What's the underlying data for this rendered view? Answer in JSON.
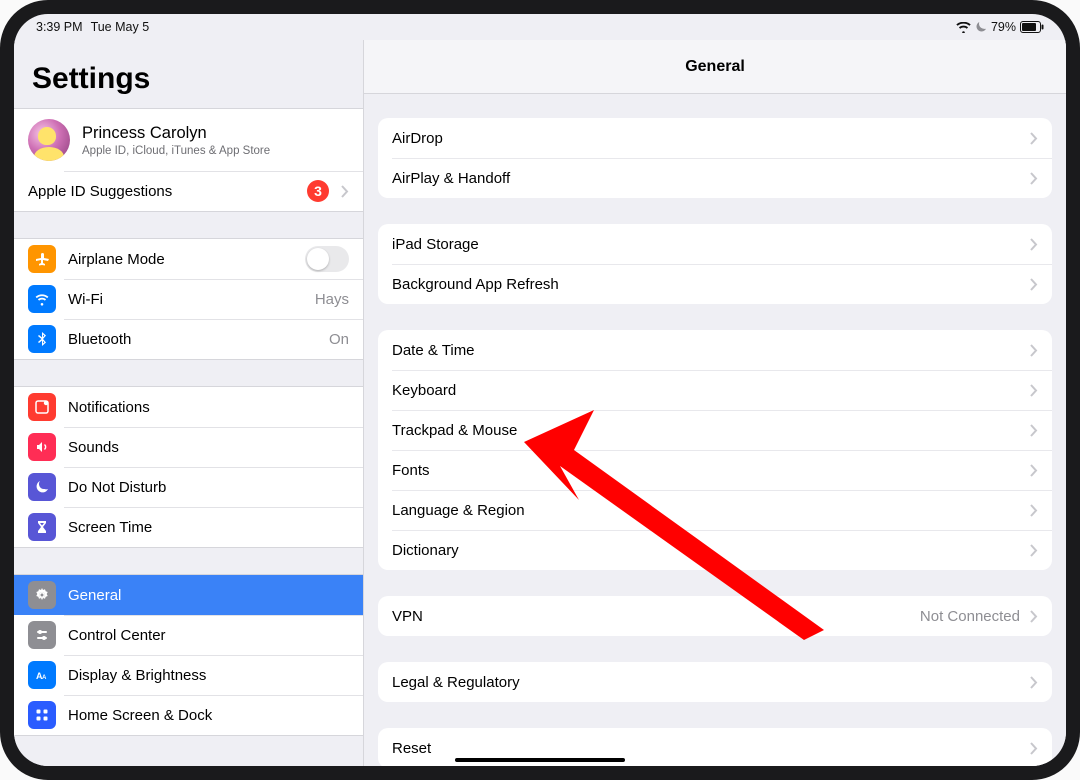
{
  "status": {
    "time": "3:39 PM",
    "date": "Tue May 5",
    "battery_pct": "79%"
  },
  "sidebar": {
    "title": "Settings",
    "account": {
      "name": "Princess Carolyn",
      "subtitle": "Apple ID, iCloud, iTunes & App Store"
    },
    "apple_id_suggestions": {
      "label": "Apple ID Suggestions",
      "badge": "3"
    },
    "airplane_mode": {
      "label": "Airplane Mode",
      "on": false,
      "icon_bg": "#ff9500"
    },
    "wifi": {
      "label": "Wi-Fi",
      "value": "Hays",
      "icon_bg": "#007aff"
    },
    "bluetooth": {
      "label": "Bluetooth",
      "value": "On",
      "icon_bg": "#007aff"
    },
    "notifications": {
      "label": "Notifications",
      "icon_bg": "#ff3b30"
    },
    "sounds": {
      "label": "Sounds",
      "icon_bg": "#ff3b30"
    },
    "dnd": {
      "label": "Do Not Disturb",
      "icon_bg": "#5856d6"
    },
    "screen_time": {
      "label": "Screen Time",
      "icon_bg": "#5856d6"
    },
    "general": {
      "label": "General",
      "icon_bg": "#8e8e93"
    },
    "control_center": {
      "label": "Control Center",
      "icon_bg": "#8e8e93"
    },
    "display": {
      "label": "Display & Brightness",
      "icon_bg": "#007aff"
    },
    "home_screen": {
      "label": "Home Screen & Dock",
      "icon_bg": "#2a5cff"
    }
  },
  "detail": {
    "header": "General",
    "groups": [
      {
        "rows": [
          {
            "label": "AirDrop"
          },
          {
            "label": "AirPlay & Handoff"
          }
        ]
      },
      {
        "rows": [
          {
            "label": "iPad Storage"
          },
          {
            "label": "Background App Refresh"
          }
        ]
      },
      {
        "rows": [
          {
            "label": "Date & Time"
          },
          {
            "label": "Keyboard"
          },
          {
            "label": "Trackpad & Mouse"
          },
          {
            "label": "Fonts"
          },
          {
            "label": "Language & Region"
          },
          {
            "label": "Dictionary"
          }
        ]
      },
      {
        "rows": [
          {
            "label": "VPN",
            "value": "Not Connected"
          }
        ]
      },
      {
        "rows": [
          {
            "label": "Legal & Regulatory"
          }
        ]
      },
      {
        "rows": [
          {
            "label": "Reset"
          }
        ]
      }
    ]
  }
}
